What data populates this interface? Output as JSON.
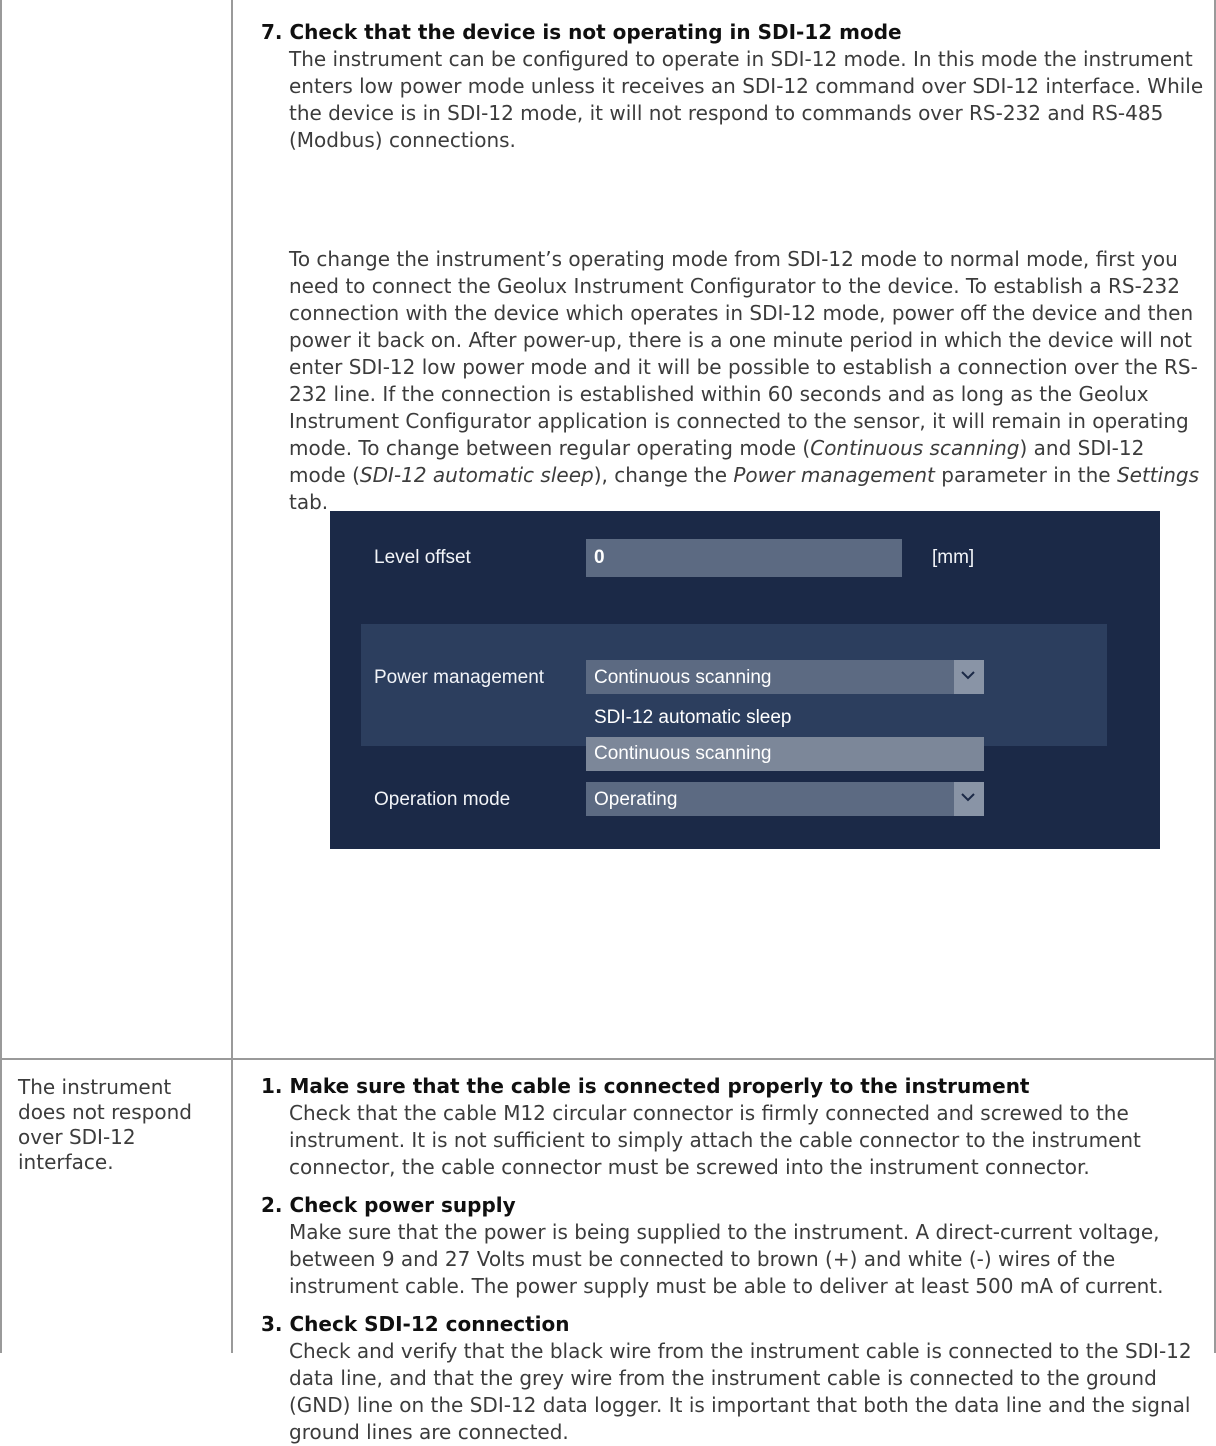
{
  "row1": {
    "step7_heading": "7. Check that the device is not operating in SDI-12 mode",
    "step7_para1": "The instrument can be configured to operate in SDI-12 mode. In this mode the instrument enters low power mode unless it receives an SDI-12 command over SDI-12 interface. While the device is in SDI-12 mode, it will not respond to commands over RS-232 and RS-485 (Modbus) connections.",
    "step7_para2_a": "To change the instrument’s operating mode from SDI-12 mode to normal mode, first you need to connect the Geolux Instrument Configurator to the device. To establish a RS-232 connection with the device which operates in SDI-12 mode, power off the device and then power it back on. After power-up, there is a one minute period in which the device will not enter SDI-12 low power mode and it will be possible to establish a connection over the RS-232 line. If the connection is established within 60 seconds and as long as the Geolux Instrument Configurator application is connected to the sensor, it will remain in operating mode. To change between regular operating mode (",
    "step7_para2_i1": "Continuous scanning",
    "step7_para2_b": ") and SDI-12 mode (",
    "step7_para2_i2": "SDI-12 automatic sleep",
    "step7_para2_c": "), change the ",
    "step7_para2_i3": "Power management",
    "step7_para2_d": " parameter in the ",
    "step7_para2_i4": "Settings",
    "step7_para2_e": " tab."
  },
  "settings_screenshot": {
    "level_offset_label": "Level offset",
    "level_offset_value": "0",
    "level_offset_unit": "[mm]",
    "power_management_label": "Power management",
    "power_management_value": "Continuous scanning",
    "power_management_options": [
      "SDI-12 automatic sleep",
      "Continuous scanning"
    ],
    "operation_mode_label": "Operation mode",
    "operation_mode_value": "Operating",
    "colors": {
      "background": "#1b2947",
      "band": "#2c3e5e",
      "field": "#5c6a82"
    }
  },
  "row2": {
    "problem": "The instrument does not respond over SDI-12 interface.",
    "step1_heading": "1. Make sure that the cable is connected properly to the instrument",
    "step1_para": "Check that the cable M12 circular connector is firmly connected and screwed to the instrument. It is not sufficient to simply attach the cable connector to the instrument connector, the cable connector must be screwed into the instrument connector.",
    "step2_heading": "2. Check power supply",
    "step2_para": "Make sure that the power is being supplied to the instrument. A direct-current voltage, between 9 and 27 Volts must be connected to brown (+) and white (-) wires of the instrument cable. The power supply must be able to deliver at least 500 mA of current.",
    "step3_heading": "3. Check SDI-12 connection",
    "step3_para": "Check and verify that the black wire from the instrument cable is connected to the SDI-12 data line, and that the grey wire from the instrument cable is connected to the ground (GND) line on the SDI-12 data logger. It is important that both the data line and the signal ground lines are connected."
  }
}
